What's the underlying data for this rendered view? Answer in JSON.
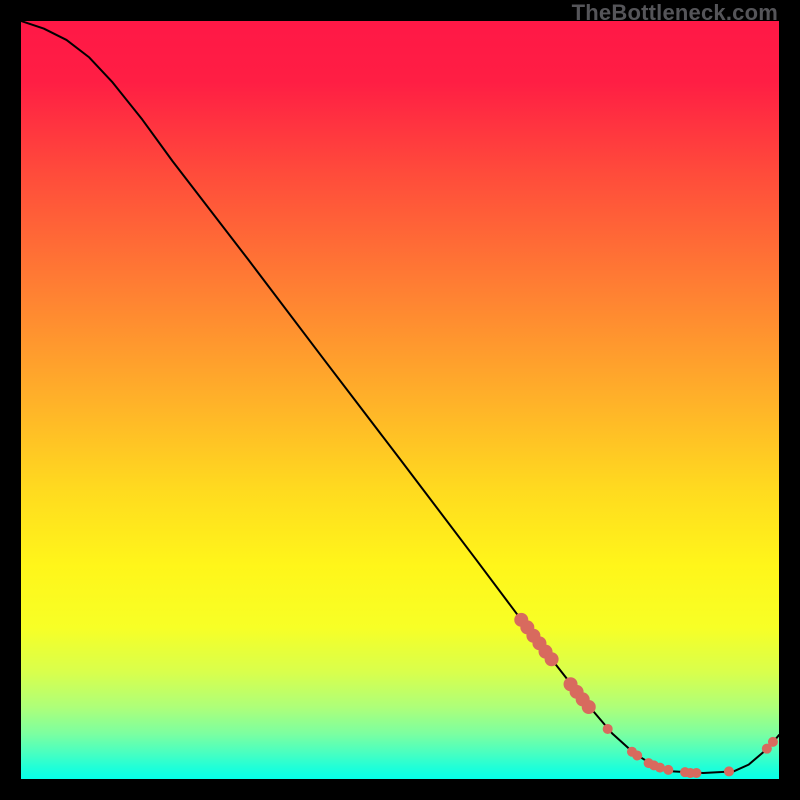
{
  "watermark": "TheBottleneck.com",
  "chart_data": {
    "type": "line",
    "title": "",
    "xlabel": "",
    "ylabel": "",
    "xlim": [
      0,
      100
    ],
    "ylim": [
      0,
      100
    ],
    "grid": false,
    "background_gradient": {
      "stops": [
        {
          "offset": 0.0,
          "color": "#ff1846"
        },
        {
          "offset": 0.08,
          "color": "#ff1e44"
        },
        {
          "offset": 0.2,
          "color": "#ff4b3b"
        },
        {
          "offset": 0.35,
          "color": "#ff7e33"
        },
        {
          "offset": 0.5,
          "color": "#ffb129"
        },
        {
          "offset": 0.62,
          "color": "#ffdb1f"
        },
        {
          "offset": 0.72,
          "color": "#fff61a"
        },
        {
          "offset": 0.8,
          "color": "#f7ff26"
        },
        {
          "offset": 0.86,
          "color": "#d8ff4d"
        },
        {
          "offset": 0.905,
          "color": "#aeff79"
        },
        {
          "offset": 0.94,
          "color": "#7cffa0"
        },
        {
          "offset": 0.965,
          "color": "#4affc0"
        },
        {
          "offset": 0.985,
          "color": "#1fffd8"
        },
        {
          "offset": 1.0,
          "color": "#06ffe9"
        }
      ]
    },
    "series": [
      {
        "name": "bottleneck-curve",
        "color": "#000000",
        "points": [
          {
            "x": 0.0,
            "y": 100.0
          },
          {
            "x": 3.0,
            "y": 99.0
          },
          {
            "x": 6.0,
            "y": 97.5
          },
          {
            "x": 9.0,
            "y": 95.2
          },
          {
            "x": 12.0,
            "y": 92.0
          },
          {
            "x": 16.0,
            "y": 87.0
          },
          {
            "x": 20.0,
            "y": 81.5
          },
          {
            "x": 30.0,
            "y": 68.5
          },
          {
            "x": 40.0,
            "y": 55.3
          },
          {
            "x": 50.0,
            "y": 42.2
          },
          {
            "x": 60.0,
            "y": 29.0
          },
          {
            "x": 66.0,
            "y": 21.0
          },
          {
            "x": 70.0,
            "y": 15.8
          },
          {
            "x": 74.0,
            "y": 10.7
          },
          {
            "x": 78.0,
            "y": 6.0
          },
          {
            "x": 81.0,
            "y": 3.3
          },
          {
            "x": 83.5,
            "y": 1.8
          },
          {
            "x": 86.0,
            "y": 1.0
          },
          {
            "x": 90.0,
            "y": 0.8
          },
          {
            "x": 94.0,
            "y": 1.0
          },
          {
            "x": 96.0,
            "y": 1.9
          },
          {
            "x": 98.0,
            "y": 3.6
          },
          {
            "x": 99.0,
            "y": 4.6
          },
          {
            "x": 100.0,
            "y": 5.8
          }
        ]
      }
    ],
    "markers": {
      "name": "highlighted-points",
      "color": "#d86a5e",
      "radius_small": 5,
      "radius_large": 7,
      "points": [
        {
          "x": 66.0,
          "y": 21.0,
          "r": 7
        },
        {
          "x": 66.8,
          "y": 20.0,
          "r": 7
        },
        {
          "x": 67.6,
          "y": 18.9,
          "r": 7
        },
        {
          "x": 68.4,
          "y": 17.9,
          "r": 7
        },
        {
          "x": 69.2,
          "y": 16.8,
          "r": 7
        },
        {
          "x": 70.0,
          "y": 15.8,
          "r": 7
        },
        {
          "x": 72.5,
          "y": 12.5,
          "r": 7
        },
        {
          "x": 73.3,
          "y": 11.5,
          "r": 7
        },
        {
          "x": 74.1,
          "y": 10.5,
          "r": 7
        },
        {
          "x": 74.9,
          "y": 9.5,
          "r": 7
        },
        {
          "x": 77.4,
          "y": 6.6,
          "r": 5
        },
        {
          "x": 80.6,
          "y": 3.6,
          "r": 5
        },
        {
          "x": 81.3,
          "y": 3.1,
          "r": 5
        },
        {
          "x": 82.8,
          "y": 2.1,
          "r": 5
        },
        {
          "x": 83.5,
          "y": 1.8,
          "r": 5
        },
        {
          "x": 84.3,
          "y": 1.5,
          "r": 5
        },
        {
          "x": 85.4,
          "y": 1.2,
          "r": 5
        },
        {
          "x": 87.6,
          "y": 0.9,
          "r": 5
        },
        {
          "x": 88.3,
          "y": 0.8,
          "r": 5
        },
        {
          "x": 89.1,
          "y": 0.8,
          "r": 5
        },
        {
          "x": 93.4,
          "y": 1.0,
          "r": 5
        },
        {
          "x": 98.4,
          "y": 4.0,
          "r": 5
        },
        {
          "x": 99.2,
          "y": 4.9,
          "r": 5
        }
      ]
    }
  }
}
